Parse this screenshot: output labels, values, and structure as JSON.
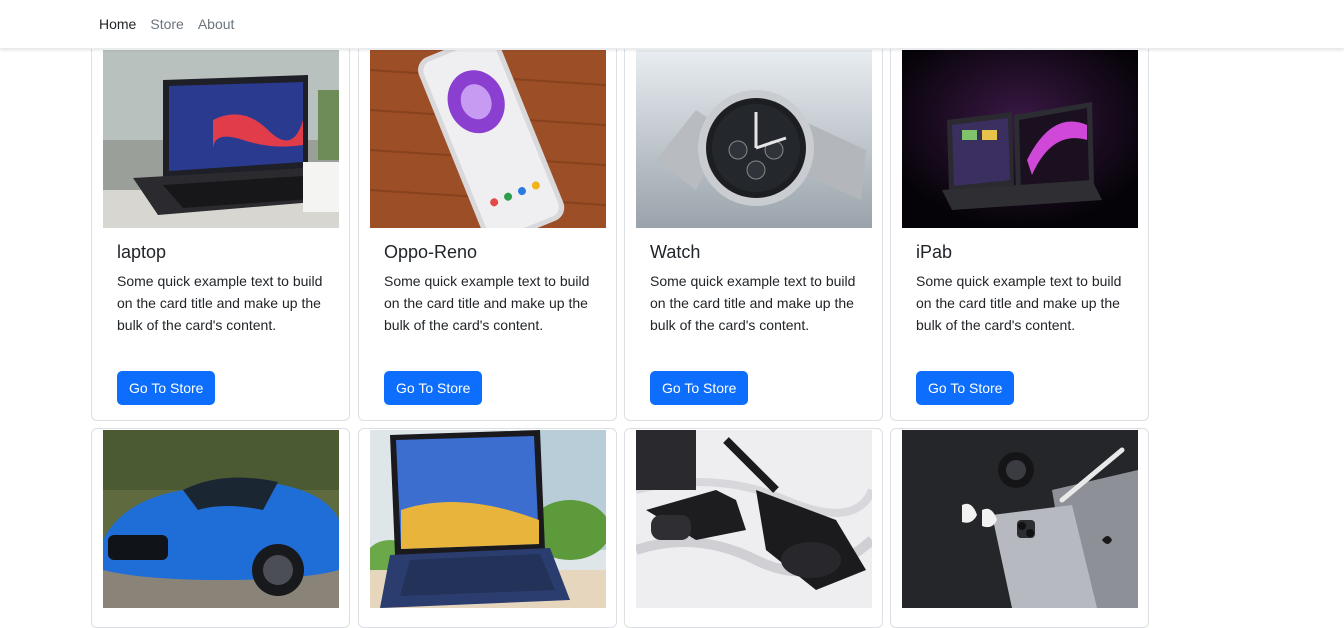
{
  "nav": {
    "items": [
      {
        "label": "Home",
        "active": true
      },
      {
        "label": "Store",
        "active": false
      },
      {
        "label": "About",
        "active": false
      }
    ]
  },
  "cards": [
    {
      "title": "laptop",
      "text": "Some quick example text to build on the card title and make up the bulk of the card's content.",
      "button": "Go To Store",
      "image": "laptop-photo"
    },
    {
      "title": "Oppo-Reno",
      "text": "Some quick example text to build on the card title and make up the bulk of the card's content.",
      "button": "Go To Store",
      "image": "phone-photo"
    },
    {
      "title": "Watch",
      "text": "Some quick example text to build on the card title and make up the bulk of the card's content.",
      "button": "Go To Store",
      "image": "watch-photo"
    },
    {
      "title": "iPab",
      "text": "Some quick example text to build on the card title and make up the bulk of the card's content.",
      "button": "Go To Store",
      "image": "ipad-photo"
    },
    {
      "image": "sports-car-photo"
    },
    {
      "image": "tablet-keyboard-photo"
    },
    {
      "image": "smart-glasses-photo"
    },
    {
      "image": "apple-devices-photo"
    }
  ],
  "colors": {
    "primary": "#0d6efd",
    "card_border": "#dcdfe3",
    "nav_active": "#212529",
    "nav_inactive": "#6c757d"
  }
}
